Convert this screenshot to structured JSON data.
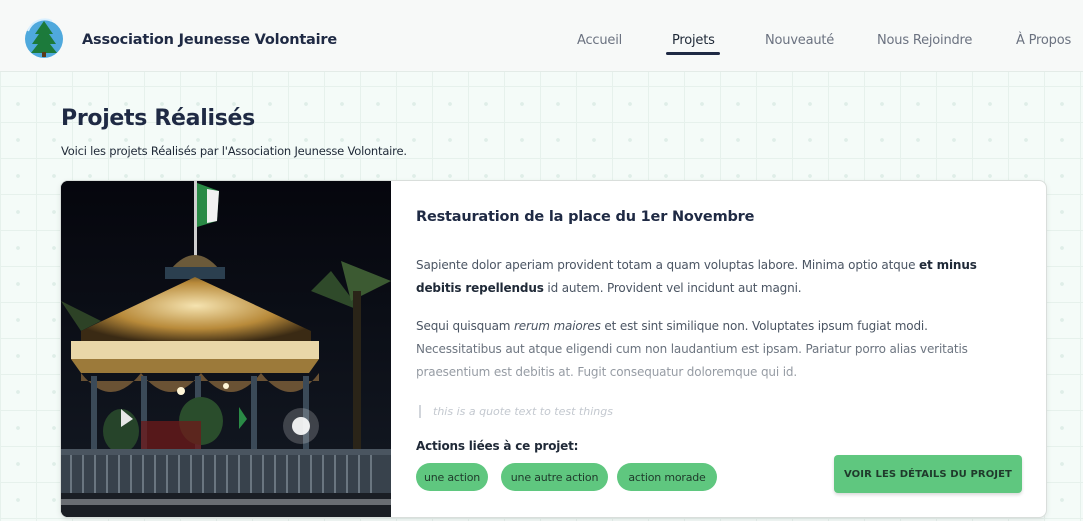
{
  "header": {
    "brand": "Association Jeunesse Volontaire",
    "logo_icon": "tree-logo-icon",
    "nav": [
      "Accueil",
      "Projets",
      "Nouveauté",
      "Nous Rejoindre",
      "À Propos"
    ],
    "active_nav": "Projets"
  },
  "page": {
    "title": "Projets Réalisés",
    "subtitle": "Voici les projets Réalisés par l'Association Jeunesse Volontaire."
  },
  "project": {
    "image_description_icon": "kiosk-photo",
    "title": "Restauration de la place du 1er Novembre",
    "p1_a": "Sapiente dolor aperiam provident totam a quam voluptas labore. Minima optio atque ",
    "p1_bold": "et minus debitis repellendus",
    "p1_b": " id autem. Provident vel incidunt aut magni.",
    "p2_a": "Sequi quisquam ",
    "p2_italic": "rerum maiores",
    "p2_b": " et est sint similique non. Voluptates ipsum fugiat modi. Necessitatibus aut atque eligendi cum non laudantium est ipsam. Pariatur porro alias veritatis praesentium est debitis at. Fugit consequatur doloremque qui id.",
    "quote": "this is a quote text to test things",
    "actions_label": "Actions liées à ce projet:",
    "actions": [
      "une action",
      "une autre action",
      "action morade"
    ],
    "cta_label": "Voir les détails du projet"
  },
  "colors": {
    "accent_green": "#5fc77f",
    "heading_navy": "#1f2a44"
  }
}
